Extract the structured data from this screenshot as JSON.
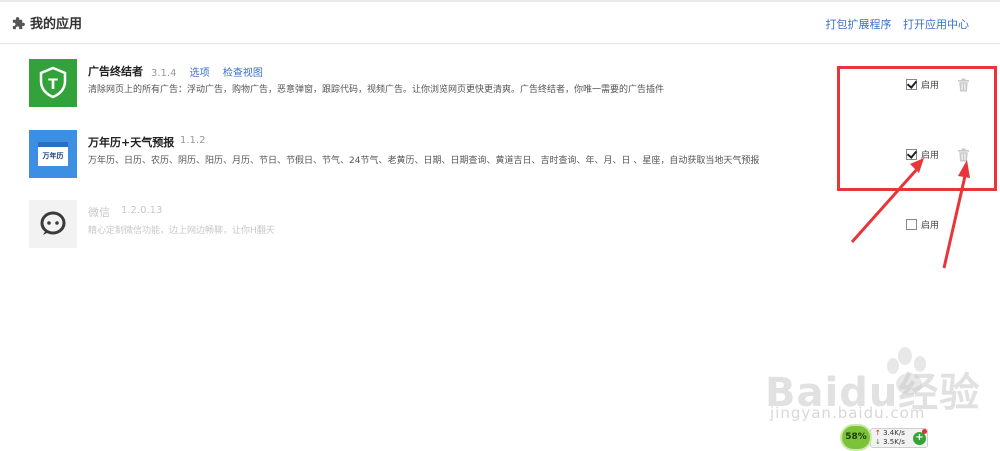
{
  "header": {
    "title": "我的应用",
    "pack_link": "打包扩展程序",
    "open_center_link": "打开应用中心"
  },
  "apps": [
    {
      "name": "广告终结者",
      "version": "3.1.4",
      "links": [
        "选项",
        "检查视图"
      ],
      "description": "清除网页上的所有广告：浮动广告，购物广告，恶意弹窗，跟踪代码，视频广告。让你浏览网页更快更清爽。广告终结者，你唯一需要的广告插件",
      "icon": "shield-t-icon",
      "icon_color": "#34a23a",
      "enabled": true,
      "enable_label": "启用"
    },
    {
      "name": "万年历+天气预报",
      "version": "1.1.2",
      "description": "万年历、日历、农历、阴历、阳历、月历、节日、节假日、节气、24节气、老黄历、日期、日期查询、黄道吉日、吉时查询、年、月、日 、星座，自动获取当地天气预报",
      "icon": "calendar-icon",
      "icon_color": "#3d8fe3",
      "icon_text": "万年历",
      "icon_subtext": "万年历",
      "enabled": true,
      "enable_label": "启用"
    },
    {
      "name": "微信",
      "version": "1.2.0.13",
      "description": "精心定制微信功能，边上网边畅聊，让你H翻天",
      "icon": "wechat-chat-icon",
      "icon_color": "#f2f2f2",
      "enabled": false,
      "enable_label": "启用"
    }
  ],
  "watermark": {
    "brand": "Baidu经验",
    "url": "jingyan.baidu.com"
  },
  "net_widget": {
    "percent": "58%",
    "upload": "3.4K/s",
    "download": "3.5K/s"
  },
  "colors": {
    "link": "#3b6fc8",
    "annotation_red": "#e8353b"
  }
}
